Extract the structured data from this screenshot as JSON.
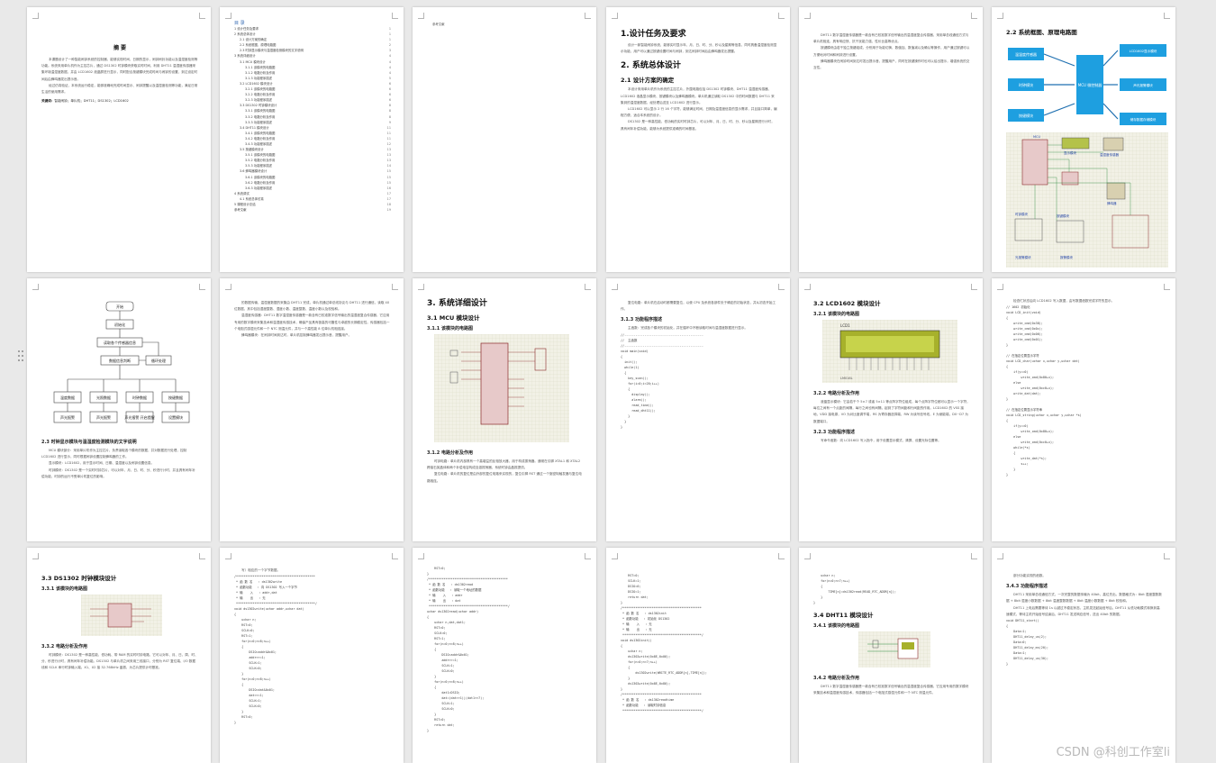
{
  "watermark": "CSDN @科创工作室li",
  "page1": {
    "title": "摘 要",
    "paragraphs": [
      "本课题设计了一种智能闹钟系统的控制器，能够实现时间、日期的显示，闹钟闹铃功能以及温湿度检测等功能。系统采用单片机作为主控芯片，通过 DS1302 时钟模块获取实时时间，利用 DHT11 温湿度传感器采集环境温湿度数据，并由 LCD1602 液晶屏进行显示，同时配合按键模块完成时间与闹钟的设置，到达设定时间后由蜂鸣器发出提示音。",
      "经过仿真验证，本系统运行稳定，能够准确地完成时间显示、闹钟提醒以及温湿度检测等功能，满足日常生活的使用需求。"
    ],
    "keywords_label": "关键词：",
    "keywords": "智能闹钟；单片机；DHT11；DS1302；LCD1602"
  },
  "page2": {
    "title": "目 录",
    "toc": [
      {
        "t": "1 设计任务及要求",
        "p": "1",
        "l": 1
      },
      {
        "t": "2 系统总体设计",
        "p": "1",
        "l": 1
      },
      {
        "t": "2.1 设计方案的确定",
        "p": "1",
        "l": 2
      },
      {
        "t": "2.2 系统框图、原理电路图",
        "p": "2",
        "l": 2
      },
      {
        "t": "2.3 时钟显示模块与温湿度检测模块的文字说明",
        "p": "3",
        "l": 2
      },
      {
        "t": "3 系统详细设计",
        "p": "4",
        "l": 1
      },
      {
        "t": "3.1 MCU 模块设计",
        "p": "4",
        "l": 2
      },
      {
        "t": "3.1.1 该模块的电路图",
        "p": "4",
        "l": 3
      },
      {
        "t": "3.1.2 电路分析及作用",
        "p": "4",
        "l": 3
      },
      {
        "t": "3.1.3 功能程序描述",
        "p": "5",
        "l": 3
      },
      {
        "t": "3.2 LCD1602 模块设计",
        "p": "6",
        "l": 2
      },
      {
        "t": "3.2.1 该模块的电路图",
        "p": "6",
        "l": 3
      },
      {
        "t": "3.2.2 电路分析及作用",
        "p": "6",
        "l": 3
      },
      {
        "t": "3.2.3 功能程序描述",
        "p": "6",
        "l": 3
      },
      {
        "t": "3.3 DS1302 时钟模块设计",
        "p": "8",
        "l": 2
      },
      {
        "t": "3.3.1 该模块的电路图",
        "p": "8",
        "l": 3
      },
      {
        "t": "3.3.2 电路分析及作用",
        "p": "8",
        "l": 3
      },
      {
        "t": "3.3.3 功能程序描述",
        "p": "9",
        "l": 3
      },
      {
        "t": "3.4 DHT11 模块设计",
        "p": "11",
        "l": 2
      },
      {
        "t": "3.4.1 该模块的电路图",
        "p": "11",
        "l": 3
      },
      {
        "t": "3.4.2 电路分析及作用",
        "p": "11",
        "l": 3
      },
      {
        "t": "3.4.3 功能程序描述",
        "p": "12",
        "l": 3
      },
      {
        "t": "3.5 按键模块设计",
        "p": "13",
        "l": 2
      },
      {
        "t": "3.5.1 该模块的电路图",
        "p": "13",
        "l": 3
      },
      {
        "t": "3.5.2 电路分析及作用",
        "p": "13",
        "l": 3
      },
      {
        "t": "3.5.3 功能程序描述",
        "p": "14",
        "l": 3
      },
      {
        "t": "3.6 蜂鸣器模块设计",
        "p": "15",
        "l": 2
      },
      {
        "t": "3.6.1 该模块的电路图",
        "p": "15",
        "l": 3
      },
      {
        "t": "3.6.2 电路分析及作用",
        "p": "15",
        "l": 3
      },
      {
        "t": "3.6.3 功能程序描述",
        "p": "16",
        "l": 3
      },
      {
        "t": "4 系统调试",
        "p": "17",
        "l": 1
      },
      {
        "t": "4.1 系统总体仿真",
        "p": "17",
        "l": 2
      },
      {
        "t": "5 课程设计总结",
        "p": "18",
        "l": 1
      },
      {
        "t": "参考文献",
        "p": "19",
        "l": 1
      }
    ]
  },
  "page3": {
    "line": "参考文献"
  },
  "page4": {
    "h1a": "1.设计任务及要求",
    "p1": "设计一款智能闹钟系统，能够实时显示年、月、日、时、分、秒以及星期等信息，同时具备温湿度检测显示功能，用户可以通过按键设置时间与闹钟，到达闹钟时间后由蜂鸣器发出提醒。",
    "h1b": "2. 系统总体设计",
    "h2a": "2.1 设计方案的确定",
    "p2": "本设计采用单片机作为系统的主控芯片，外围电路包括 DS1302 时钟模块、DHT11 温湿度传感器、LCD1602 液晶显示模块、按键模块以及蜂鸣器模块。单片机通过读取 DS1302 中的时间数据与 DHT11 采集到的温湿度数据，经处理后送至 LCD1602 进行显示。",
    "p3": "LCD1602 可以显示 2 行 16 个字符，能够满足时间、日期及温湿度信息的显示需求，并且接口简单，编程方便，适合本系统的设计。",
    "p4": "DS1302 是一种高性能、低功耗的实时时钟芯片，可以对年、月、日、时、分、秒以及星期进行计时，具有闰年补偿功能，能够为系统提供准确的时间基准。"
  },
  "page5": {
    "p1": "DHT11 数字温湿度传感器是一款含有已校准数字信号输出的温湿度复合传感器，采用单总线通信方式与单片机相连，具有响应快、抗干扰能力强、性价比高等优点。",
    "p2": "按键模块由若干独立按键组成，分别用于功能切换、数值加、数值减以及确认等操作，用户通过按键可以方便地对时间和闹钟进行设置。",
    "p3": "蜂鸣器模块在闹钟时间到达时发出提示音，提醒用户，同时在按键操作时也可以给出提示，增强系统的交互性。"
  },
  "page6": {
    "title": "2.2 系统框图、原理电路图",
    "blocks": {
      "temp": "温湿度传感器",
      "clock": "时钟模块",
      "key": "按键模块",
      "mcu": "MCU\n微控制器",
      "lcd": "LCD1602显示模块",
      "buzzer": "声光报警模块",
      "storage": "储存数据存储模块"
    },
    "sch_labels": [
      "MCU",
      "显示模块",
      "温湿度传感器",
      "时钟模块",
      "按键模块",
      "蜂鸣器",
      "光报警模块",
      "报警模块"
    ]
  },
  "page7": {
    "flow": {
      "start": "开始",
      "init": "初始化",
      "read": "读取各个传感器信息",
      "analyze": "数据信息判断",
      "cycle": "循环处理",
      "b1": "温度数据",
      "b2": "光照数据",
      "b3": "时钟数据",
      "b4": "按键数据",
      "c1": "声光报警",
      "c2": "声光报警",
      "c3": "声光报警\n开启提醒",
      "c4": "设置模块"
    },
    "h2": "2.3 时钟显示模块与温湿度检测模块的文字说明",
    "p1": "MCU 模块部分：采用单片机作为主控芯片，负责读取各个模块的数据，并对数据进行处理，控制 LCD1602 进行显示，同时根据闹钟设置控制蜂鸣器的工作。",
    "p2": "显示模块：LCD1602，用于显示时间、日期、温湿度以及闹钟设置信息。",
    "p3": "时钟模块：DS1302 是一个实时时钟芯片，可以对年、月、日、时、分、秒进行计时，并且具有闰年补偿功能，时钟的运行不受单片机复位的影响。"
  },
  "page8": {
    "p1": "的数据传输，温湿度数据的采集由 DHT11 完成，单片机通过单总线协议与 DHT11 进行通信，读取 40 位数据，其中包括湿度整数、湿度小数、温度整数、温度小数以及校验和。",
    "p2": "温湿度传感器：DHT11 数字温湿度传感器是一款含有已校准数字信号输出的温湿度复合传感器，它应用专用的数字模块采集技术和温湿度传感技术，确保产品具有极高的可靠性与卓越的长期稳定性。传感器包括一个电阻式感湿元件和一个 NTC 测温元件，并与一个高性能 8 位单片机相连接。",
    "p3": "蜂鸣器模块：在闹钟时间到达时，单片机控制蜂鸣器发出提示音，提醒用户。"
  },
  "page9": {
    "h1": "3. 系统详细设计",
    "h2": "3.1 MCU 模块设计",
    "h3a": "3.1.1 该模块的电路图",
    "h3b": "3.1.2 电路分析及作用",
    "p1": "时钟电路：单片机内部具有一个高增益的反相放大器，用于构成振荡器。通常在引脚 XTAL1 和 XTAL2 跨接石英晶体和两个补偿电容构成自激振荡器，系统时钟由晶振提供。",
    "p2": "复位电路：单片机的复位是由外部的复位电路来实现的，复位引脚 RST 通过一个施密特触发器与复位电路相连。"
  },
  "page10": {
    "p1": "复位电路：单片机在启动时都需要复位，以使 CPU 及系统各部件处于确定的初始状态，并从初态开始工作。",
    "h3": "3.1.3 功能程序描述",
    "p2": "主函数：完成各个模块的初始化，并在循环中不断读取时间与温湿度数据进行显示。",
    "code": "//-------------------------------------------\n//  主函数\n//-------------------------------------------\nvoid main(void)\n{\n  init();\n  while(1)\n  {\n    key_scan();\n    for(i=0;i<20;i++)\n    {\n      display();\n      alarm();\n      read_time();\n      read_dht11();\n    }\n  }\n}"
  },
  "page11": {
    "h2": "3.2 LCD1602 模块设计",
    "h3a": "3.2.1 该模块的电路图",
    "lcd_label": "LCD1",
    "lcd_model": "LM016L",
    "h3b": "3.2.2 电路分析及作用",
    "p1": "液晶显示模块：它由若干个 5×7 或者 5×11 等点阵字符位组成，每个点阵字符位都可以显示一个字符，每位之间有一个点距的间隔，每行之间也有间隔，起到了字符间距和行间距的作用。LCD1602 的 VSS 接地，VDD 接电源，VO 为对比度调节端，RS 为寄存器选择端，RW 为读写信号线，E 为使能端，D0~D7 为数据端口。",
    "h3c": "3.2.3 功能程序描述",
    "p2": "写命令函数：向 LCD1602 写入指令，用于设置显示模式、清屏、设置光标位置等。"
  },
  "page12": {
    "p1": "检查忙状态后向 LCD1602 写入数据，由写数据函数完成字符的显示。",
    "code": "// 1602 初始化\nvoid LCD_init(void)\n{\n    write_cmd(0x38);\n    write_cmd(0x0c);\n    write_cmd(0x06);\n    write_cmd(0x01);\n}\n\n// 在指定位置显示字符\nvoid LCD_char(uchar x,uchar y,uchar dat)\n{\n    if(y==0)\n        write_cmd(0x80+x);\n    else\n        write_cmd(0xc0+x);\n    write_dat(dat);\n}\n\n// 在指定位置显示字符串\nvoid LCD_string(uchar x,uchar y,uchar *s)\n{\n    if(y==0)\n        write_cmd(0x80+x);\n    else\n        write_cmd(0xc0+x);\n    while(*s)\n    {\n        write_dat(*s);\n        s++;\n    }\n}"
  },
  "page13": {
    "h2": "3.3 DS1302 时钟模块设计",
    "h3a": "3.3.1 该模块的电路图",
    "h3b": "3.3.2 电路分析及作用",
    "p1": "时钟模块：DS1302 是一种高性能、低功耗、带 RAM 的实时时钟电路，它可以对年、月、日、周、时、分、秒进行计时，具有闰年补偿功能。DS1302 与单片机之间采用三线接口，分别为 RST 复位端、I/O 数据线和 SCLK 串行时钟输入端。X1、X2 接 32.768kHz 晶振，为芯片提供计时基准。"
  },
  "page14": {
    "p1": "写）相应的一个字节数据。",
    "code": "/*******************************************\n * 函 数 名   : ds1302write\n * 函数功能   : 向 DS1302 写入一个字节\n * 输    入   : addr,dat\n * 输    出   : 无\n *******************************************/\nvoid ds1302write(uchar addr,uchar dat)\n{\n    uchar n;\n    RST=0;\n    SCLK=0;\n    RST=1;\n    for(n=0;n<8;n++)\n    {\n        DSIO=addr&0x01;\n        addr>>=1;\n        SCLK=1;\n        SCLK=0;\n    }\n    for(n=0;n<8;n++)\n    {\n        DSIO=dat&0x01;\n        dat>>=1;\n        SCLK=1;\n        SCLK=0;\n    }\n    RST=0;\n}"
  },
  "page15": {
    "code": "    RST=0;\n}\n/*******************************************\n * 函 数 名   : ds1302read\n * 函数功能   : 读取一个地址的数据\n * 输    入   : addr\n * 输    出   : dat\n *******************************************/\nuchar ds1302read(uchar addr)\n{\n    uchar n,dat,dat1;\n    RST=0;\n    SCLK=0;\n    RST=1;\n    for(n=0;n<8;n++)\n    {\n        DSIO=addr&0x01;\n        addr>>=1;\n        SCLK=1;\n        SCLK=0;\n    }\n    for(n=0;n<8;n++)\n    {\n        dat1=DSIO;\n        dat=(dat>>1)|(dat1<<7);\n        SCLK=1;\n        SCLK=0;\n    }\n    RST=0;\n    return dat;\n}"
  },
  "page16": {
    "code": "    RST=0;\n    SCLK=1;\n    DSIO=0;\n    DSIO=1;\n    return dat;\n}\n/*******************************************\n * 函 数 名   : ds1302init\n * 函数功能   : 初始化 DS1302\n * 输    入   : 无\n * 输    出   : 无\n *******************************************/\nvoid ds1302init()\n{\n    uchar n;\n    ds1302write(0x8E,0x00);\n    for(n=0;n<7;n++)\n    {\n        ds1302write(WRITE_RTC_ADDR[n],TIME[n]);\n    }\n    ds1302write(0x8E,0x80);\n}\n/*******************************************\n * 函 数 名   : ds1302readtime\n * 函数功能   : 读取时钟信息\n *******************************************/"
  },
  "page17": {
    "code": "    uchar n;\n    for(n=0;n<7;n++)\n    {\n        TIME[n]=ds1302read(READ_RTC_ADDR[n]);\n    }\n}",
    "h2": "3.4 DHT11 模块设计",
    "h3a": "3.4.1 该模块的电路图",
    "h3b": "3.4.2 电路分析及作用",
    "p1": "DHT11 数字温湿度传感器是一款含有已校准数字信号输出的温湿度复合传感器，它应用专用的数字模块采集技术和温湿度传感技术，传感器包括一个电阻式感湿元件和一个 NTC 测温元件。"
  },
  "page18": {
    "p0": "部分功能实现的函数。",
    "h3": "3.4.3 功能程序描述",
    "p1": "DHT11 采用单总线通信方式，一次完整的数据传输为 40bit，高位先出。数据格式为：8bit 湿度整数数据 + 8bit 湿度小数数据 + 8bit 温度整数数据 + 8bit 温度小数数据 + 8bit 校验和。",
    "p2": "DHT11 上电后需要等待 1s 以越过不稳定状态，主机发送起始信号后，DHT11 从低功耗模式转换到高速模式，等待主机开始信号结束后，DHT11 发送响应信号，送出 40bit 的数据。",
    "code": "void DHT11_start()\n{\n    Data=1;\n    DHT11_delay_us(2);\n    Data=0;\n    DHT11_delay_ms(20);\n    Data=1;\n    DHT11_delay_us(30);\n}"
  }
}
